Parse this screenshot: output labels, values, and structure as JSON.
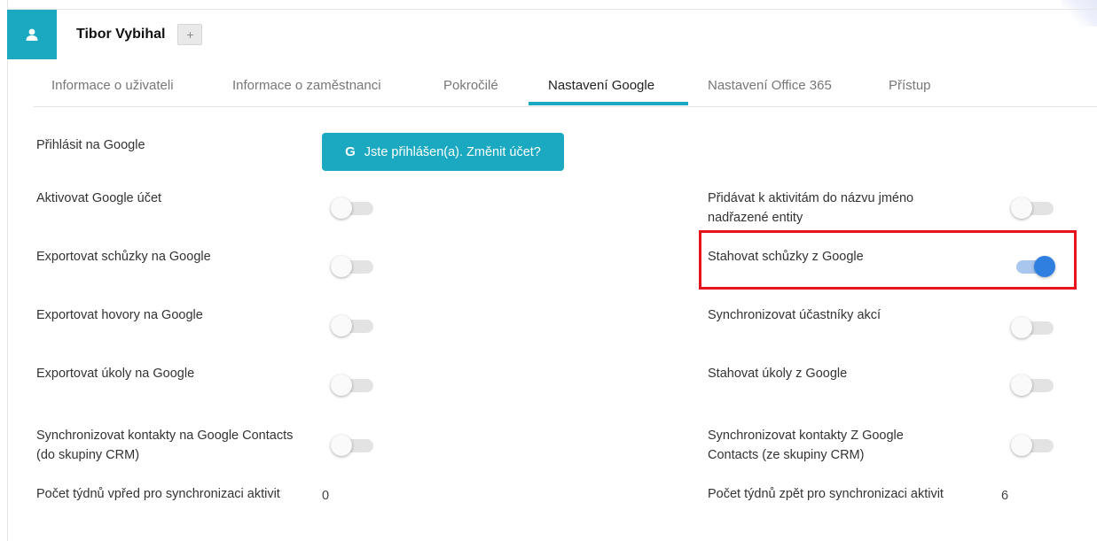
{
  "header": {
    "user_name": "Tibor Vybihal",
    "add_label": "+",
    "avatar_icon": "user-icon",
    "accent_color": "#1aa9c0"
  },
  "tabs": [
    {
      "label": "Informace o uživateli",
      "active": false
    },
    {
      "label": "Informace o zaměstnanci",
      "active": false
    },
    {
      "label": "Pokročilé",
      "active": false
    },
    {
      "label": "Nastavení Google",
      "active": true
    },
    {
      "label": "Nastavení Office 365",
      "active": false
    },
    {
      "label": "Přístup",
      "active": false
    }
  ],
  "google_login": {
    "label": "Přihlásit na Google",
    "button_icon": "G",
    "button_text": "Jste přihlášen(a). Změnit účet?"
  },
  "left_settings": [
    {
      "label": "Aktivovat Google účet",
      "checked": false
    },
    {
      "label": "Exportovat schůzky na Google",
      "checked": false
    },
    {
      "label": "Exportovat hovory na Google",
      "checked": false
    },
    {
      "label": "Exportovat úkoly na Google",
      "checked": false
    },
    {
      "label": "Synchronizovat kontakty na Google Contacts (do skupiny CRM)",
      "checked": false
    }
  ],
  "right_settings": [
    {
      "label": "Přidávat k aktivitám do názvu jméno nadřazené entity",
      "checked": false
    },
    {
      "label": "Stahovat schůzky z Google",
      "checked": true,
      "highlighted": true
    },
    {
      "label": "Synchronizovat účastníky akcí",
      "checked": false
    },
    {
      "label": "Stahovat úkoly z Google",
      "checked": false
    },
    {
      "label": "Synchronizovat kontakty Z Google Contacts (ze skupiny CRM)",
      "checked": false
    }
  ],
  "weeks_forward": {
    "label": "Počet týdnů vpřed pro synchronizaci aktivit",
    "value": "0"
  },
  "weeks_back": {
    "label": "Počet týdnů zpět pro synchronizaci aktivit",
    "value": "6"
  },
  "colors": {
    "toggle_on": "#2f7fe0",
    "highlight_border": "#e8141d"
  }
}
